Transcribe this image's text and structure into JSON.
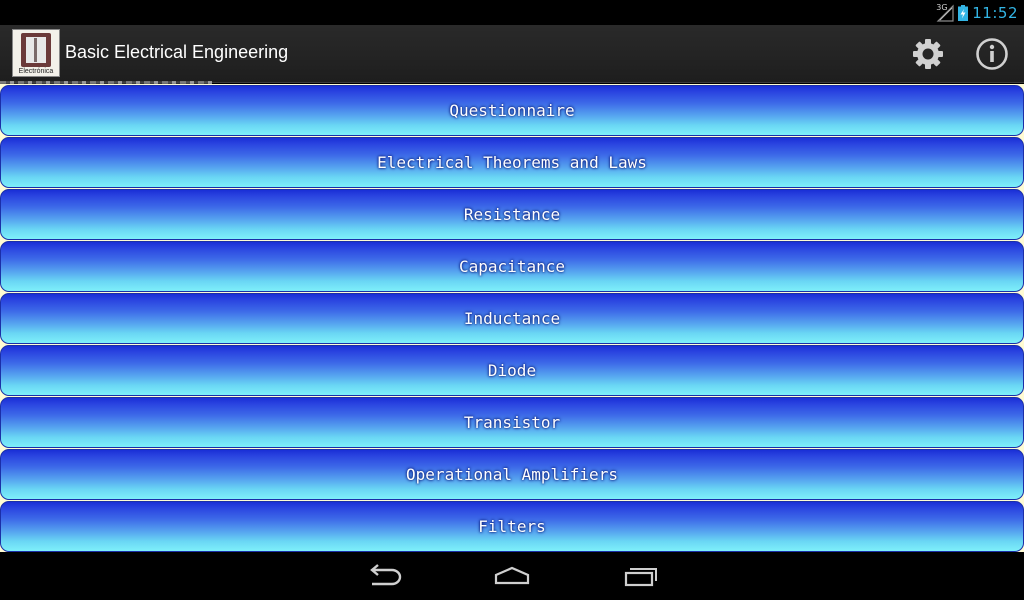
{
  "status_bar": {
    "network": "3G",
    "time": "11:52",
    "time_color": "#33b5e5"
  },
  "action_bar": {
    "app_icon_label": "Electrónica",
    "title": "Basic Electrical Engineering",
    "settings_icon": "gear-icon",
    "info_icon": "info-icon"
  },
  "menu": {
    "background": "#fffbd3",
    "items": [
      {
        "label": "Questionnaire"
      },
      {
        "label": "Electrical Theorems and Laws"
      },
      {
        "label": "Resistance"
      },
      {
        "label": "Capacitance"
      },
      {
        "label": "Inductance"
      },
      {
        "label": "Diode"
      },
      {
        "label": "Transistor"
      },
      {
        "label": "Operational Amplifiers"
      },
      {
        "label": "Filters"
      }
    ]
  },
  "nav_bar": {
    "back_icon": "back-icon",
    "home_icon": "home-icon",
    "recent_icon": "recent-apps-icon"
  }
}
